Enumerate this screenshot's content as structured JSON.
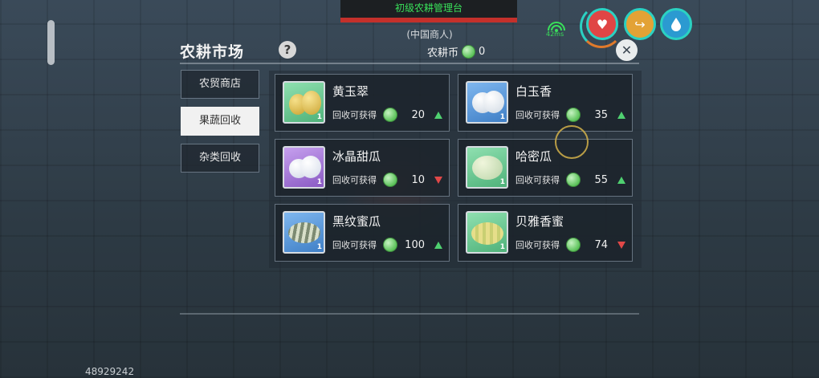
{
  "hud": {
    "banner": "初级农耕管理台",
    "npc_name": "(中国商人)",
    "ping": "42ms",
    "stat_icons": [
      "heart-icon",
      "food-icon",
      "water-drop-icon"
    ]
  },
  "market": {
    "title": "农耕市场",
    "help_label": "?",
    "coin_label": "农耕币",
    "coin_amount": "0",
    "close_label": "✕"
  },
  "tabs": [
    {
      "label": "农贸商店",
      "active": false
    },
    {
      "label": "果蔬回收",
      "active": true
    },
    {
      "label": "杂类回收",
      "active": false
    }
  ],
  "items": [
    {
      "name": "黄玉翠",
      "recycle_label": "回收可获得",
      "value": "20",
      "trend": "up",
      "level": "1",
      "bg": "green"
    },
    {
      "name": "白玉香",
      "recycle_label": "回收可获得",
      "value": "35",
      "trend": "up",
      "level": "1",
      "bg": "blue"
    },
    {
      "name": "冰晶甜瓜",
      "recycle_label": "回收可获得",
      "value": "10",
      "trend": "down",
      "level": "1",
      "bg": "purple"
    },
    {
      "name": "哈密瓜",
      "recycle_label": "回收可获得",
      "value": "55",
      "trend": "up",
      "level": "1",
      "bg": "green"
    },
    {
      "name": "黑纹蜜瓜",
      "recycle_label": "回收可获得",
      "value": "100",
      "trend": "up",
      "level": "1",
      "bg": "blue"
    },
    {
      "name": "贝雅香蜜",
      "recycle_label": "回收可获得",
      "value": "74",
      "trend": "down",
      "level": "1",
      "bg": "green"
    }
  ],
  "footer": {
    "uid": "48929242"
  }
}
